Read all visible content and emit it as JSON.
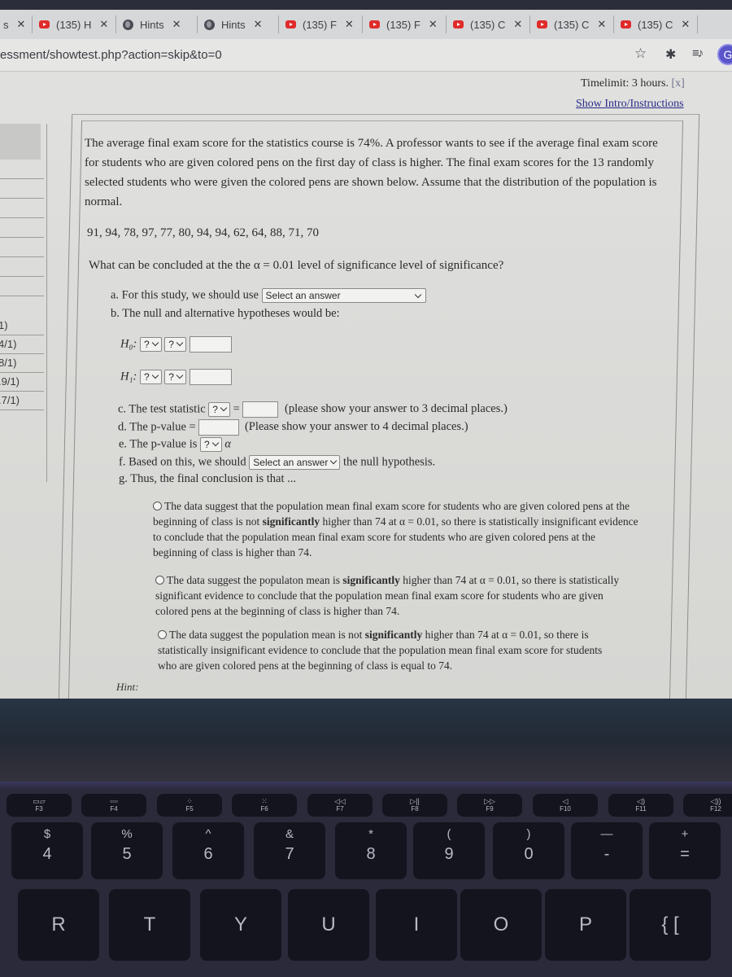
{
  "browser": {
    "tabs": [
      {
        "title": "s",
        "icon": "partial-tab"
      },
      {
        "title": "(135) H",
        "icon": "youtube-icon"
      },
      {
        "title": "Hints",
        "icon": "globe-icon"
      },
      {
        "title": "Hints",
        "icon": "globe-icon"
      },
      {
        "title": "(135) F",
        "icon": "youtube-icon"
      },
      {
        "title": "(135) F",
        "icon": "youtube-icon"
      },
      {
        "title": "(135) C",
        "icon": "youtube-icon"
      },
      {
        "title": "(135) C",
        "icon": "youtube-icon"
      },
      {
        "title": "(135) C",
        "icon": "youtube-icon"
      }
    ],
    "tab_close_glyph": "✕",
    "url": "essment/showtest.php?action=skip&to=0",
    "profile_initial": "G",
    "star_glyph": "☆",
    "extensions_glyph": "✱",
    "media_glyph": "≡♪"
  },
  "sidebar": {
    "rows": [
      "",
      "",
      "",
      "",
      "",
      "",
      "",
      "1)",
      "4/1)",
      "8/1)",
      ".9/1)",
      ".7/1)"
    ]
  },
  "header": {
    "timelimit": "Timelimit: 3 hours.",
    "timelimit_close": "[x]",
    "intro_link": "Show Intro/Instructions"
  },
  "problem": {
    "text": "The average final exam score for the statistics course is 74%. A professor wants to see if the average final exam score for students who are given colored pens on the first day of class is higher. The final exam scores for the 13 randomly selected students who were given the colored pens are shown below. Assume that the distribution of the population is normal.",
    "data_values": "91, 94, 78, 97, 77, 80, 94, 94, 62, 64, 88, 71, 70",
    "question": "What can be concluded at the the α = 0.01 level of significance level of significance?"
  },
  "parts": {
    "a_label": "a. For this study, we should use",
    "a_select": "Select an answer",
    "b_label": "b. The null and alternative hypotheses would be:",
    "h0_label": "H₀:",
    "h1_label": "H₁:",
    "q_select": "?",
    "c_label": "c. The test statistic",
    "c_equals": "=",
    "c_note": "(please show your answer to 3 decimal places.)",
    "d_label": "d. The p-value =",
    "d_note": "(Please show your answer to 4 decimal places.)",
    "e_label": "e. The p-value is",
    "e_alpha": "α",
    "f_label": "f. Based on this, we should",
    "f_select": "Select an answer",
    "f_suffix": "the null hypothesis.",
    "g_label": "g. Thus, the final conclusion is that ..."
  },
  "options": [
    {
      "pre": "The data suggest that the population mean final exam score for students who are given colored pens at the beginning of class is not ",
      "bold": "significantly",
      "post": " higher than 74 at α = 0.01, so there is statistically insignificant evidence to conclude that the population mean final exam score for students who are given colored pens at the beginning of class is higher than 74."
    },
    {
      "pre": "The data suggest the populaton mean is ",
      "bold": "significantly",
      "post": " higher than 74 at α = 0.01, so there is statistically significant evidence to conclude that the population mean final exam score for students who are given colored pens at the beginning of class is higher than 74."
    },
    {
      "pre": "The data suggest the population mean is not ",
      "bold": "significantly",
      "post": " higher than 74 at α = 0.01, so there is statistically insignificant evidence to conclude that the population mean final exam score for students who are given colored pens at the beginning of class is equal to 74."
    }
  ],
  "hint_label": "Hint:",
  "keyboard": {
    "fkeys": [
      {
        "label": "F3",
        "glyph": "▭▱"
      },
      {
        "label": "F4",
        "glyph": "▫▫▫"
      },
      {
        "label": "F5",
        "glyph": "⁘"
      },
      {
        "label": "F6",
        "glyph": "⁙"
      },
      {
        "label": "F7",
        "glyph": "◁◁"
      },
      {
        "label": "F8",
        "glyph": "▷||"
      },
      {
        "label": "F9",
        "glyph": "▷▷"
      },
      {
        "label": "F10",
        "glyph": "◁"
      },
      {
        "label": "F11",
        "glyph": "◁)"
      },
      {
        "label": "F12",
        "glyph": "◁))"
      }
    ],
    "number_row": [
      {
        "shift": "$",
        "main": "4"
      },
      {
        "shift": "%",
        "main": "5"
      },
      {
        "shift": "^",
        "main": "6"
      },
      {
        "shift": "&",
        "main": "7"
      },
      {
        "shift": "*",
        "main": "8"
      },
      {
        "shift": "(",
        "main": "9"
      },
      {
        "shift": ")",
        "main": "0"
      },
      {
        "shift": "—",
        "main": "-"
      },
      {
        "shift": "+",
        "main": "="
      }
    ],
    "letter_row": [
      "R",
      "T",
      "Y",
      "U",
      "I",
      "O",
      "P",
      "{ ["
    ]
  }
}
